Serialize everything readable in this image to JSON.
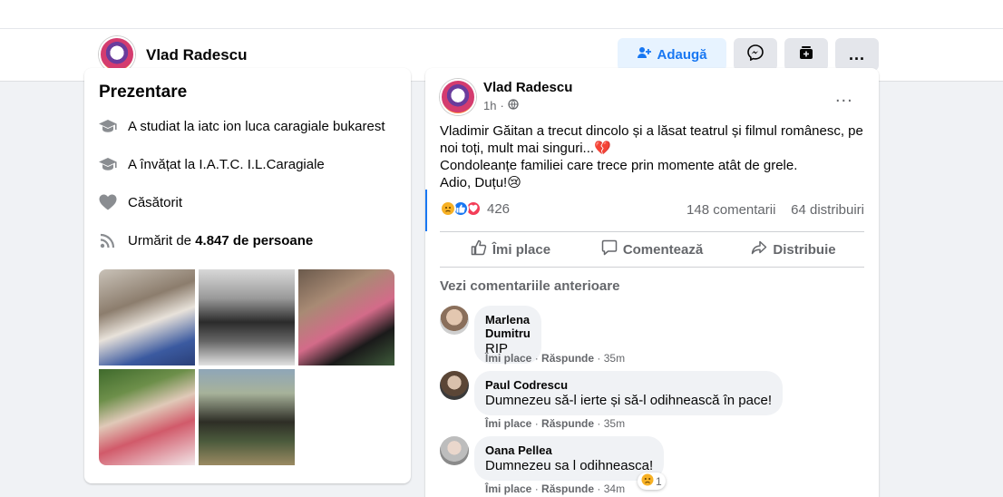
{
  "profile_header": {
    "name": "Vlad Radescu",
    "add_button_label": "Adaugă",
    "more_label": "..."
  },
  "intro": {
    "title": "Prezentare",
    "items": [
      {
        "icon": "graduation-cap-icon",
        "text": "A studiat la iatc ion luca caragiale bukarest"
      },
      {
        "icon": "graduation-cap-icon",
        "text": "A învățat la I.A.T.C. I.L.Caragiale"
      },
      {
        "icon": "heart-icon",
        "text": "Căsătorit"
      }
    ],
    "followers_prefix": "Urmărit de ",
    "followers_count": "4.847 de persoane",
    "followers_icon": "rss-icon"
  },
  "post": {
    "author": "Vlad Radescu",
    "time": "1h",
    "privacy_icon": "globe-icon",
    "more_label": "...",
    "text_lines": [
      "Vladimir Găitan a trecut dincolo și a lăsat teatrul și filmul românesc, pe noi toți, mult mai singuri...💔",
      "Condoleanțe familiei care trece prin momente atât de grele.",
      "Adio, Duțu!😢"
    ],
    "reaction_count": "426",
    "comments_count": "148 comentarii",
    "shares_count": "64 distribuiri",
    "actions": {
      "like": "Îmi place",
      "comment": "Comentează",
      "share": "Distribuie"
    },
    "prev_comments_label": "Vezi comentariile anterioare",
    "comments": [
      {
        "name": "Marlena Dumitru",
        "text": "RIP",
        "like": "Îmi place",
        "reply": "Răspunde",
        "time": "35m"
      },
      {
        "name": "Paul Codrescu",
        "text": "Dumnezeu să-l ierte și să-l odihnească în pace!",
        "like": "Îmi place",
        "reply": "Răspunde",
        "time": "35m"
      },
      {
        "name": "Oana Pellea",
        "text": "Dumnezeu sa l odihneasca!",
        "like": "Îmi place",
        "reply": "Răspunde",
        "time": "34m",
        "reaction_count": "1"
      }
    ]
  },
  "colors": {
    "accent": "#1877f2",
    "secondary_text": "#65676b",
    "like_blue": "#1877f2",
    "love_red": "#f33e58",
    "sad_yellow": "#f7b125"
  }
}
